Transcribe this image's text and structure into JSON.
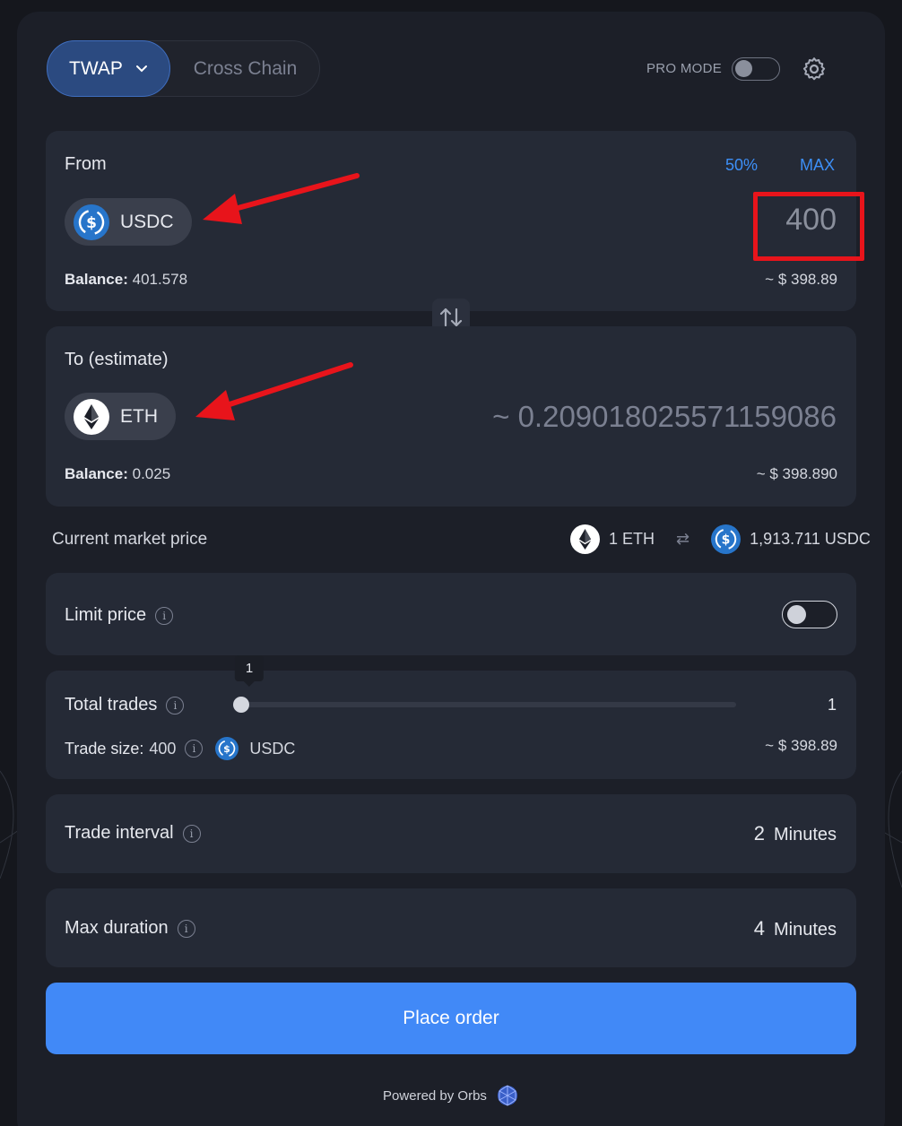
{
  "header": {
    "tab_twap": "TWAP",
    "tab_cross_chain": "Cross Chain",
    "pro_mode_label": "PRO MODE",
    "pro_mode_on": false
  },
  "from": {
    "label": "From",
    "btn_half": "50%",
    "btn_max": "MAX",
    "token": "USDC",
    "amount": "400",
    "balance_label": "Balance:",
    "balance_value": "401.578",
    "usd_value": "~ $ 398.89"
  },
  "to": {
    "label": "To (estimate)",
    "token": "ETH",
    "estimate": "~ 0.209018025571159086",
    "balance_label": "Balance:",
    "balance_value": "0.025",
    "usd_value": "~ $ 398.890"
  },
  "market": {
    "label": "Current market price",
    "left": "1 ETH",
    "right": "1,913.711 USDC"
  },
  "limit": {
    "label": "Limit price",
    "enabled": false
  },
  "trades": {
    "label": "Total trades",
    "tooltip": "1",
    "value": "1",
    "slider_value": 1,
    "size_label": "Trade size:",
    "size_value": "400",
    "size_token": "USDC",
    "size_usd": "~ $ 398.89"
  },
  "interval": {
    "label": "Trade interval",
    "value": "2",
    "unit": "Minutes"
  },
  "duration": {
    "label": "Max duration",
    "value": "4",
    "unit": "Minutes"
  },
  "place_order": "Place order",
  "powered_by": "Powered by Orbs",
  "colors": {
    "accent": "#4189f7",
    "annotation": "#e8141b"
  }
}
